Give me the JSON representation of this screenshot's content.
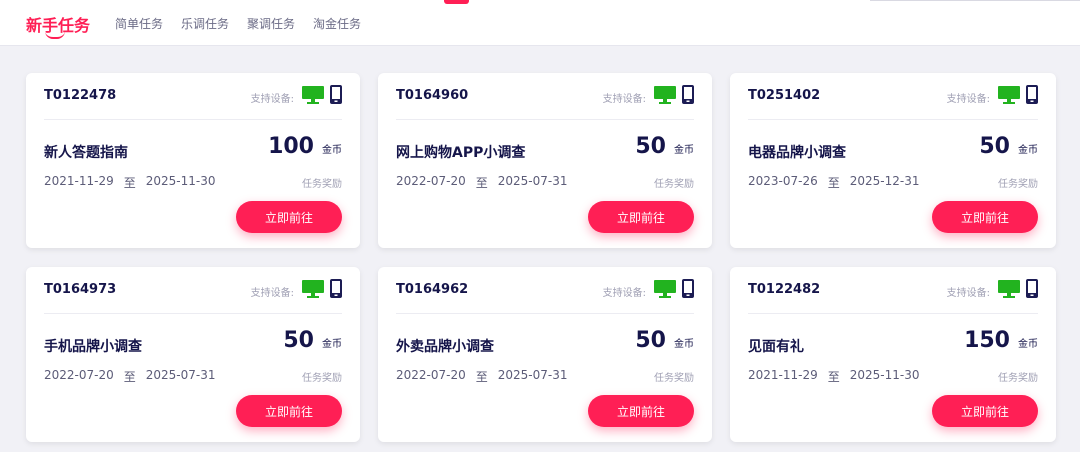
{
  "header": {
    "brand": "新手任务",
    "nav": [
      "简单任务",
      "乐调任务",
      "聚调任务",
      "淘金任务"
    ]
  },
  "colors": {
    "accent": "#ff1f55",
    "text_dark": "#15154a",
    "monitor": "#22b31f",
    "phone": "#1c1c54"
  },
  "cards": [
    {
      "id": "T0122478",
      "device_label": "支持设备:",
      "name": "新人答题指南",
      "reward": "100",
      "unit": "金币",
      "start": "2021-11-29",
      "sep": "至",
      "end": "2025-11-30",
      "reward_label": "任务奖励",
      "button": "立即前往"
    },
    {
      "id": "T0164960",
      "device_label": "支持设备:",
      "name": "网上购物APP小调查",
      "reward": "50",
      "unit": "金币",
      "start": "2022-07-20",
      "sep": "至",
      "end": "2025-07-31",
      "reward_label": "任务奖励",
      "button": "立即前往"
    },
    {
      "id": "T0251402",
      "device_label": "支持设备:",
      "name": "电器品牌小调查",
      "reward": "50",
      "unit": "金币",
      "start": "2023-07-26",
      "sep": "至",
      "end": "2025-12-31",
      "reward_label": "任务奖励",
      "button": "立即前往"
    },
    {
      "id": "T0164973",
      "device_label": "支持设备:",
      "name": "手机品牌小调查",
      "reward": "50",
      "unit": "金币",
      "start": "2022-07-20",
      "sep": "至",
      "end": "2025-07-31",
      "reward_label": "任务奖励",
      "button": "立即前往"
    },
    {
      "id": "T0164962",
      "device_label": "支持设备:",
      "name": "外卖品牌小调查",
      "reward": "50",
      "unit": "金币",
      "start": "2022-07-20",
      "sep": "至",
      "end": "2025-07-31",
      "reward_label": "任务奖励",
      "button": "立即前往"
    },
    {
      "id": "T0122482",
      "device_label": "支持设备:",
      "name": "见面有礼",
      "reward": "150",
      "unit": "金币",
      "start": "2021-11-29",
      "sep": "至",
      "end": "2025-11-30",
      "reward_label": "任务奖励",
      "button": "立即前往"
    }
  ]
}
